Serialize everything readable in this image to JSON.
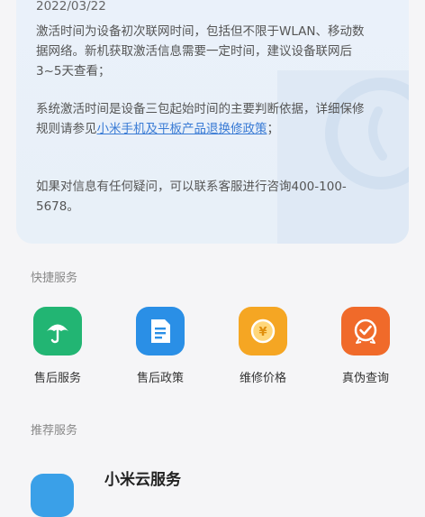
{
  "info": {
    "date": "2022/03/22",
    "paragraph1": "激活时间为设备初次联网时间，包括但不限于WLAN、移动数据网络。新机获取激活信息需要一定时间，建议设备联网后3~5天查看；",
    "paragraph2_prefix": "系统激活时间是设备三包起始时间的主要判断依据，详细保修规则请参见",
    "paragraph2_link": "小米手机及平板产品退换修政策",
    "paragraph2_suffix": "；",
    "paragraph3": "如果对信息有任何疑问，可以联系客服进行咨询400-100-5678。"
  },
  "quick_services": {
    "title": "快捷服务",
    "items": [
      {
        "label": "售后服务",
        "icon": "umbrella-icon",
        "color": "#22b573"
      },
      {
        "label": "售后政策",
        "icon": "document-icon",
        "color": "#2a8fe6"
      },
      {
        "label": "维修价格",
        "icon": "yen-coin-icon",
        "color": "#f5a623"
      },
      {
        "label": "真伪查询",
        "icon": "verified-badge-icon",
        "color": "#f06a2a"
      }
    ]
  },
  "recommended": {
    "title": "推荐服务",
    "first_item_name": "小米云服务"
  }
}
